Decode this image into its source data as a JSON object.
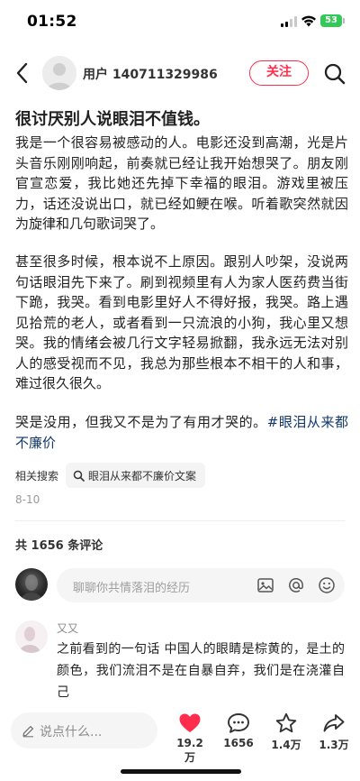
{
  "status_bar": {
    "time": "01:52",
    "battery": "53"
  },
  "header": {
    "username": "用户 140711329986",
    "follow_label": "关注",
    "back_icon": "chevron-left-icon",
    "search_icon": "search-icon",
    "accent_color": "#ff2e4d"
  },
  "post": {
    "title": "很讨厌别人说眼泪不值钱。",
    "paragraph_1": "我是一个很容易被感动的人。电影还没到高潮，光是片头音乐刚刚响起，前奏就已经让我开始想哭了。朋友刚官宣恋爱，我比她还先掉下幸福的眼泪。游戏里被压力，话还没说出口，就已经如鲠在喉。听着歌突然就因为旋律和几句歌词哭了。",
    "paragraph_2": "甚至很多时候，根本说不上原因。跟别人吵架，没说两句话眼泪先下来了。刷到视频里有人为家人医药费当街下跪，我哭。看到电影里好人不得好报，我哭。路上遇见拾荒的老人，或者看到一只流浪的小狗，我心里又想哭。我的情绪会被几行文字轻易掀翻，我永远无法对别人的感受视而不见，我总为那些根本不相干的人和事，难过很久很久。",
    "paragraph_3_text": "哭是没用，但我又不是为了有用才哭的。",
    "paragraph_3_hashtag": "#眼泪从来都不廉价",
    "related_label": "相关搜索",
    "related_query": "眼泪从来都不廉价文案",
    "date": "8-10"
  },
  "comments": {
    "count_label": "共 1656 条评论",
    "composer_placeholder": "聊聊你共情落泪的经历",
    "items": [
      {
        "author": "又又",
        "text": "之前看到的一句话 中国人的眼睛是棕黄的，是土的颜色，我们流泪不是在自暴自弃，我们是在浇灌自己"
      }
    ]
  },
  "bottom_bar": {
    "input_placeholder": "说点什么...",
    "likes": "19.2万",
    "comments": "1656",
    "stars": "1.4万",
    "shares": "1.3万",
    "like_color": "#ff2e4d"
  }
}
